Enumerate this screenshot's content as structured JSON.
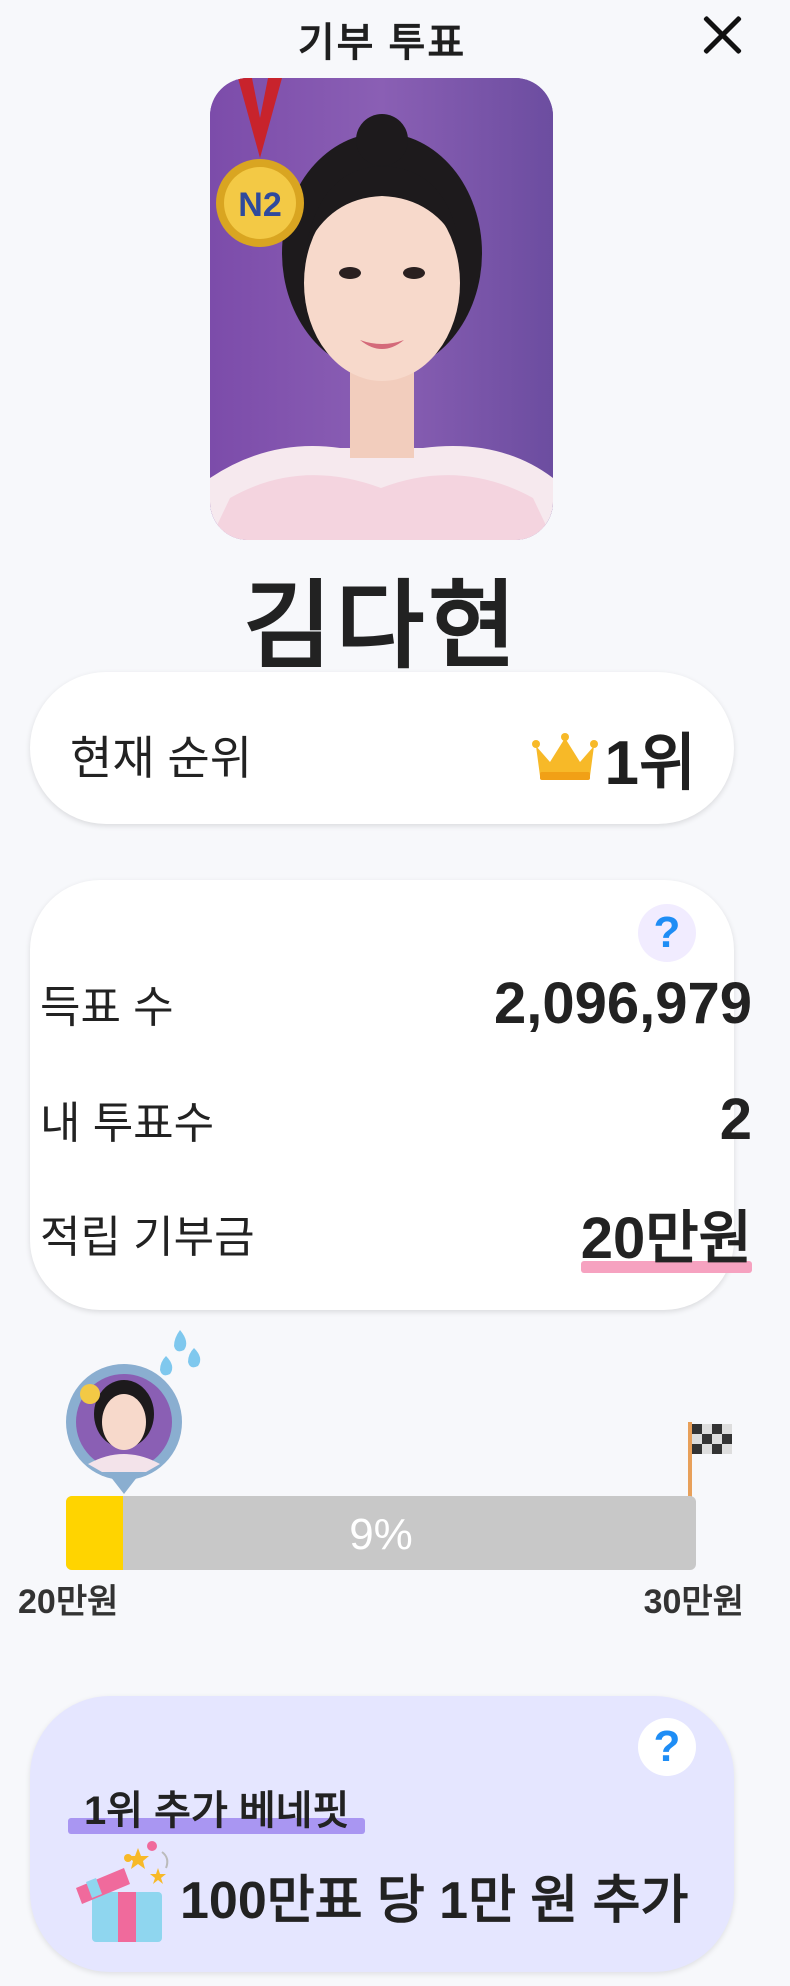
{
  "header": {
    "title": "기부 투표"
  },
  "profile": {
    "name": "김다현",
    "medal_text": "N2"
  },
  "rank": {
    "label": "현재 순위",
    "value": "1위"
  },
  "stats": {
    "votes_label": "득표 수",
    "votes_value": "2,096,979",
    "my_votes_label": "내 투표수",
    "my_votes_value": "2",
    "donation_label": "적립 기부금",
    "donation_value": "20만원"
  },
  "progress": {
    "percent_text": "9%",
    "fraction": 0.09,
    "min_label": "20만원",
    "max_label": "30만원"
  },
  "benefit": {
    "title": "1위 추가 베네핏",
    "text": "100만표 당 1만 원 추가"
  },
  "icons": {
    "close": "close-icon",
    "help": "help-icon",
    "crown": "crown-icon",
    "medal": "medal-icon",
    "flag": "checkered-flag-icon",
    "gift": "gift-icon",
    "sweat": "sweat-drop-icon"
  },
  "help_glyph": "?",
  "colors": {
    "progress_fill": "#ffd400",
    "progress_track": "#c8c8c8",
    "help_blue": "#1e8df5",
    "donation_underline": "#f6a2c0",
    "benefit_bg": "#e5e6ff",
    "benefit_underline": "#a996f2",
    "photo_bg": "#7b4ca9"
  }
}
